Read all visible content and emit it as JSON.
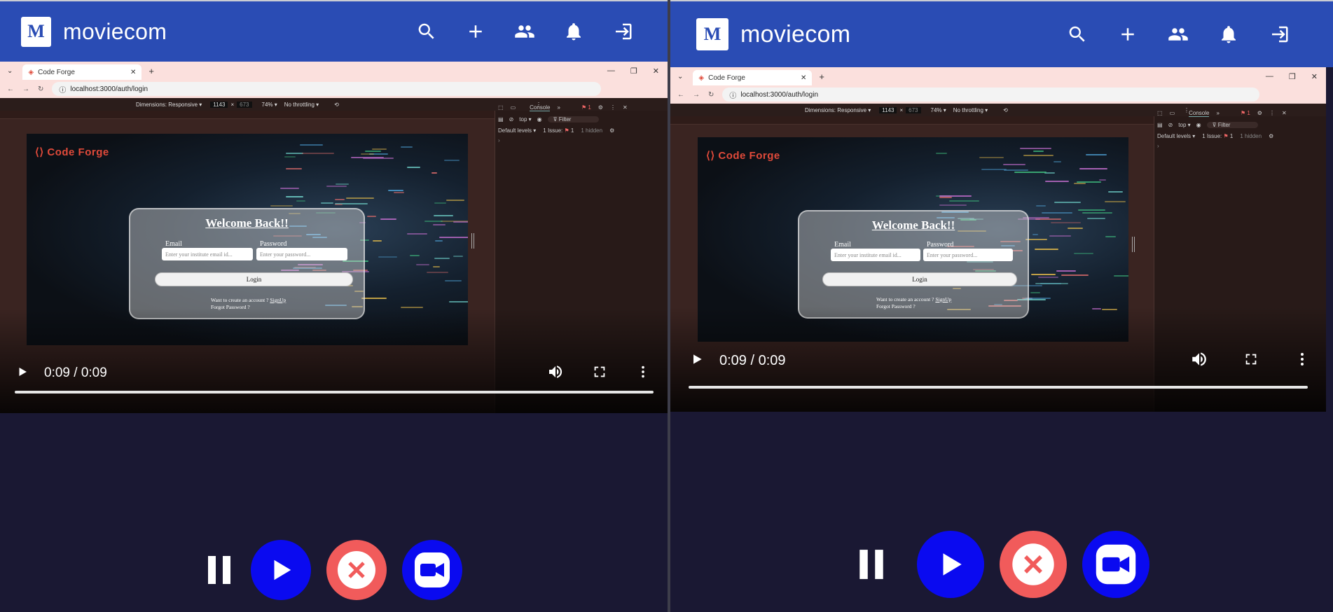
{
  "app": {
    "brand": "moviecom",
    "logo_letter": "M",
    "icons": [
      "search-icon",
      "add-icon",
      "group-icon",
      "bell-icon",
      "logout-icon"
    ]
  },
  "browser": {
    "tab_title": "Code Forge",
    "url": "localhost:3000/auth/login",
    "devtools": {
      "dimensions": "Dimensions: Responsive ▾",
      "width": "1143",
      "height": "673",
      "zoom": "74% ▾",
      "throttling": "No throttling ▾",
      "console_tab": "Console",
      "issues_badge": "1",
      "context": "top ▾",
      "filter": "Filter",
      "levels": "Default levels ▾",
      "issues": "1 Issue:",
      "issues_count": "1",
      "hidden": "1 hidden"
    }
  },
  "login": {
    "logo_text": "Code Forge",
    "title": "Welcome Back!!",
    "email_label": "Email",
    "email_placeholder": "Enter your institute email id...",
    "password_label": "Password",
    "password_placeholder": "Enter your password...",
    "login_button": "Login",
    "signup_prompt": "Want to create an account ?",
    "signup_link": "SignUp",
    "forgot": "Forgot Password ?"
  },
  "player": {
    "time": "0:09 / 0:09",
    "progress": 1.0
  },
  "colors": {
    "appbar": "#2a4cb4",
    "background": "#1a1833",
    "primary_button": "#0a0af0",
    "cancel_button": "#f15b5b"
  }
}
